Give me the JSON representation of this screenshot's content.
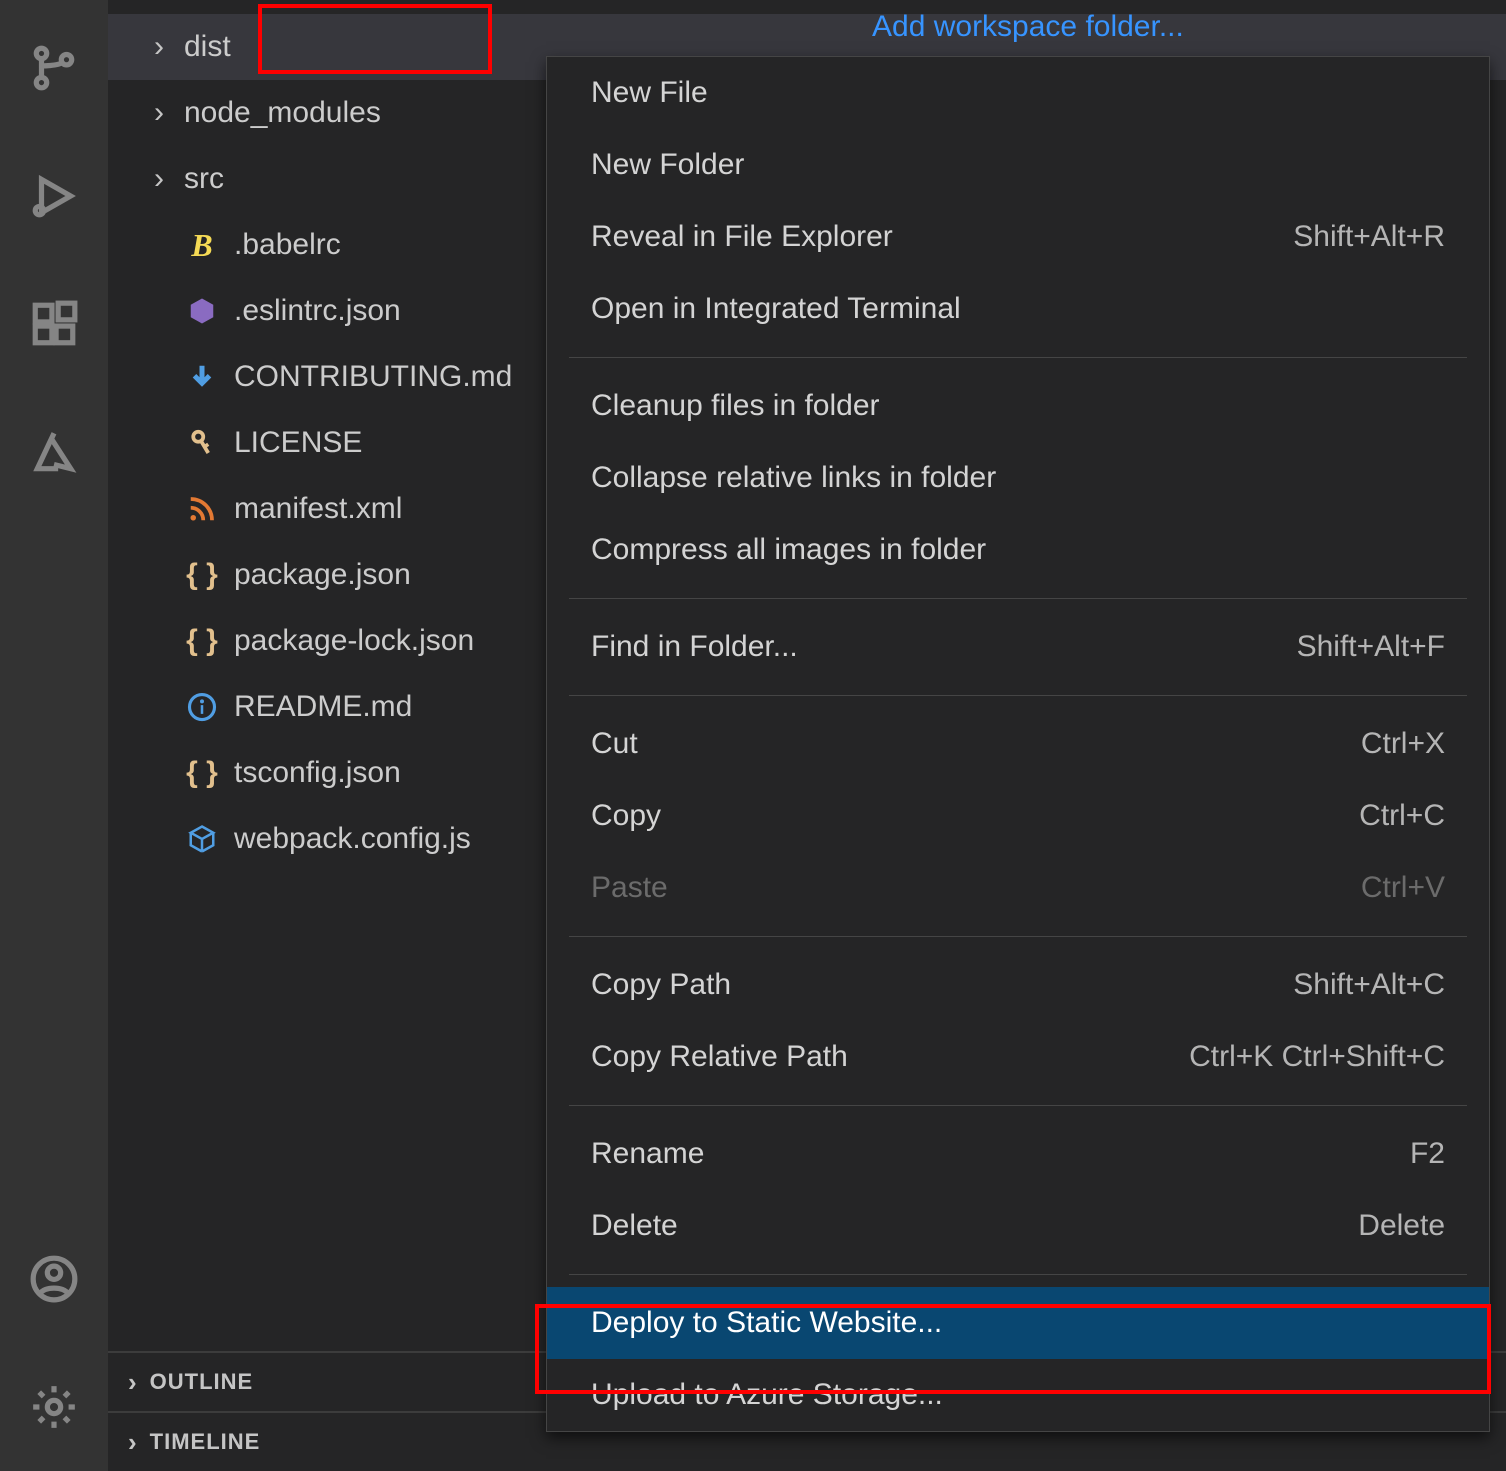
{
  "add_workspace_folder": "Add workspace folder...",
  "file_tree": [
    {
      "type": "folder",
      "label": "dist",
      "selected": true,
      "highlight": true
    },
    {
      "type": "folder",
      "label": "node_modules"
    },
    {
      "type": "folder",
      "label": "src"
    },
    {
      "type": "file",
      "label": ".babelrc",
      "icon": "babel",
      "color": "#f5da55"
    },
    {
      "type": "file",
      "label": ".eslintrc.json",
      "icon": "hex",
      "color": "#8a6bc1"
    },
    {
      "type": "file",
      "label": "CONTRIBUTING.md",
      "icon": "md-down",
      "color": "#509ee3"
    },
    {
      "type": "file",
      "label": "LICENSE",
      "icon": "key",
      "color": "#e2c08d"
    },
    {
      "type": "file",
      "label": "manifest.xml",
      "icon": "rss",
      "color": "#e37933"
    },
    {
      "type": "file",
      "label": "package.json",
      "icon": "braces",
      "color": "#e2c08d"
    },
    {
      "type": "file",
      "label": "package-lock.json",
      "icon": "braces",
      "color": "#e2c08d"
    },
    {
      "type": "file",
      "label": "README.md",
      "icon": "info",
      "color": "#509ee3"
    },
    {
      "type": "file",
      "label": "tsconfig.json",
      "icon": "braces",
      "color": "#e2c08d"
    },
    {
      "type": "file",
      "label": "webpack.config.js",
      "icon": "cube",
      "color": "#509ee3"
    }
  ],
  "panels": [
    {
      "label": "OUTLINE"
    },
    {
      "label": "TIMELINE"
    }
  ],
  "context_menu": {
    "groups": [
      [
        {
          "label": "New File",
          "shortcut": ""
        },
        {
          "label": "New Folder",
          "shortcut": ""
        },
        {
          "label": "Reveal in File Explorer",
          "shortcut": "Shift+Alt+R"
        },
        {
          "label": "Open in Integrated Terminal",
          "shortcut": ""
        }
      ],
      [
        {
          "label": "Cleanup files in folder",
          "shortcut": ""
        },
        {
          "label": "Collapse relative links in folder",
          "shortcut": ""
        },
        {
          "label": "Compress all images in folder",
          "shortcut": ""
        }
      ],
      [
        {
          "label": "Find in Folder...",
          "shortcut": "Shift+Alt+F"
        }
      ],
      [
        {
          "label": "Cut",
          "shortcut": "Ctrl+X"
        },
        {
          "label": "Copy",
          "shortcut": "Ctrl+C"
        },
        {
          "label": "Paste",
          "shortcut": "Ctrl+V",
          "disabled": true
        }
      ],
      [
        {
          "label": "Copy Path",
          "shortcut": "Shift+Alt+C"
        },
        {
          "label": "Copy Relative Path",
          "shortcut": "Ctrl+K Ctrl+Shift+C"
        }
      ],
      [
        {
          "label": "Rename",
          "shortcut": "F2"
        },
        {
          "label": "Delete",
          "shortcut": "Delete"
        }
      ],
      [
        {
          "label": "Deploy to Static Website...",
          "shortcut": "",
          "selected": true,
          "highlight": true
        },
        {
          "label": "Upload to Azure Storage...",
          "shortcut": ""
        }
      ]
    ]
  }
}
